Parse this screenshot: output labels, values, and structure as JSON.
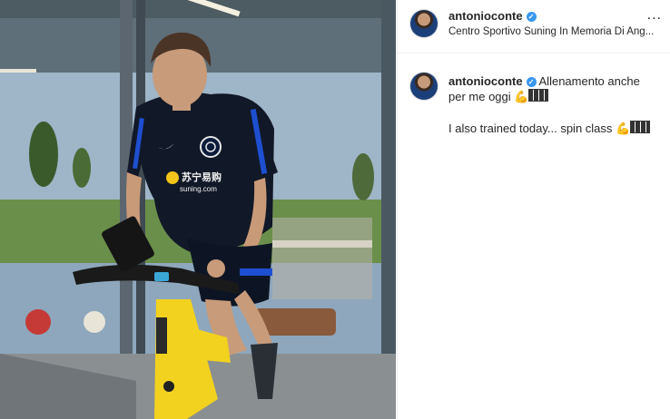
{
  "post": {
    "username": "antonioconte",
    "location": "Centro Sportivo Suning In Memoria Di Ang...",
    "more_label": "...",
    "caption_line1": "Allenamento anche per me oggi",
    "caption_line2": "I also trained today... spin class",
    "caption_emoji": "💪",
    "verified_badge": "✓"
  },
  "photo": {
    "shirt_brand": "苏宁易购",
    "shirt_sponsor": "suning.com"
  },
  "colors": {
    "verified_blue": "#3897f0",
    "bike_yellow": "#f2d21e",
    "shirt_navy": "#111827"
  }
}
